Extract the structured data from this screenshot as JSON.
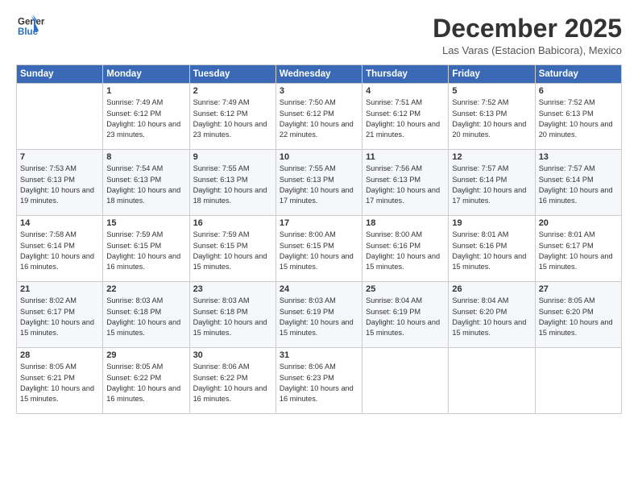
{
  "header": {
    "logo_line1": "General",
    "logo_line2": "Blue",
    "title": "December 2025",
    "subtitle": "Las Varas (Estacion Babicora), Mexico"
  },
  "columns": [
    "Sunday",
    "Monday",
    "Tuesday",
    "Wednesday",
    "Thursday",
    "Friday",
    "Saturday"
  ],
  "weeks": [
    [
      {
        "day": "",
        "sunrise": "",
        "sunset": "",
        "daylight": ""
      },
      {
        "day": "1",
        "sunrise": "Sunrise: 7:49 AM",
        "sunset": "Sunset: 6:12 PM",
        "daylight": "Daylight: 10 hours and 23 minutes."
      },
      {
        "day": "2",
        "sunrise": "Sunrise: 7:49 AM",
        "sunset": "Sunset: 6:12 PM",
        "daylight": "Daylight: 10 hours and 23 minutes."
      },
      {
        "day": "3",
        "sunrise": "Sunrise: 7:50 AM",
        "sunset": "Sunset: 6:12 PM",
        "daylight": "Daylight: 10 hours and 22 minutes."
      },
      {
        "day": "4",
        "sunrise": "Sunrise: 7:51 AM",
        "sunset": "Sunset: 6:12 PM",
        "daylight": "Daylight: 10 hours and 21 minutes."
      },
      {
        "day": "5",
        "sunrise": "Sunrise: 7:52 AM",
        "sunset": "Sunset: 6:13 PM",
        "daylight": "Daylight: 10 hours and 20 minutes."
      },
      {
        "day": "6",
        "sunrise": "Sunrise: 7:52 AM",
        "sunset": "Sunset: 6:13 PM",
        "daylight": "Daylight: 10 hours and 20 minutes."
      }
    ],
    [
      {
        "day": "7",
        "sunrise": "Sunrise: 7:53 AM",
        "sunset": "Sunset: 6:13 PM",
        "daylight": "Daylight: 10 hours and 19 minutes."
      },
      {
        "day": "8",
        "sunrise": "Sunrise: 7:54 AM",
        "sunset": "Sunset: 6:13 PM",
        "daylight": "Daylight: 10 hours and 18 minutes."
      },
      {
        "day": "9",
        "sunrise": "Sunrise: 7:55 AM",
        "sunset": "Sunset: 6:13 PM",
        "daylight": "Daylight: 10 hours and 18 minutes."
      },
      {
        "day": "10",
        "sunrise": "Sunrise: 7:55 AM",
        "sunset": "Sunset: 6:13 PM",
        "daylight": "Daylight: 10 hours and 17 minutes."
      },
      {
        "day": "11",
        "sunrise": "Sunrise: 7:56 AM",
        "sunset": "Sunset: 6:13 PM",
        "daylight": "Daylight: 10 hours and 17 minutes."
      },
      {
        "day": "12",
        "sunrise": "Sunrise: 7:57 AM",
        "sunset": "Sunset: 6:14 PM",
        "daylight": "Daylight: 10 hours and 17 minutes."
      },
      {
        "day": "13",
        "sunrise": "Sunrise: 7:57 AM",
        "sunset": "Sunset: 6:14 PM",
        "daylight": "Daylight: 10 hours and 16 minutes."
      }
    ],
    [
      {
        "day": "14",
        "sunrise": "Sunrise: 7:58 AM",
        "sunset": "Sunset: 6:14 PM",
        "daylight": "Daylight: 10 hours and 16 minutes."
      },
      {
        "day": "15",
        "sunrise": "Sunrise: 7:59 AM",
        "sunset": "Sunset: 6:15 PM",
        "daylight": "Daylight: 10 hours and 16 minutes."
      },
      {
        "day": "16",
        "sunrise": "Sunrise: 7:59 AM",
        "sunset": "Sunset: 6:15 PM",
        "daylight": "Daylight: 10 hours and 15 minutes."
      },
      {
        "day": "17",
        "sunrise": "Sunrise: 8:00 AM",
        "sunset": "Sunset: 6:15 PM",
        "daylight": "Daylight: 10 hours and 15 minutes."
      },
      {
        "day": "18",
        "sunrise": "Sunrise: 8:00 AM",
        "sunset": "Sunset: 6:16 PM",
        "daylight": "Daylight: 10 hours and 15 minutes."
      },
      {
        "day": "19",
        "sunrise": "Sunrise: 8:01 AM",
        "sunset": "Sunset: 6:16 PM",
        "daylight": "Daylight: 10 hours and 15 minutes."
      },
      {
        "day": "20",
        "sunrise": "Sunrise: 8:01 AM",
        "sunset": "Sunset: 6:17 PM",
        "daylight": "Daylight: 10 hours and 15 minutes."
      }
    ],
    [
      {
        "day": "21",
        "sunrise": "Sunrise: 8:02 AM",
        "sunset": "Sunset: 6:17 PM",
        "daylight": "Daylight: 10 hours and 15 minutes."
      },
      {
        "day": "22",
        "sunrise": "Sunrise: 8:03 AM",
        "sunset": "Sunset: 6:18 PM",
        "daylight": "Daylight: 10 hours and 15 minutes."
      },
      {
        "day": "23",
        "sunrise": "Sunrise: 8:03 AM",
        "sunset": "Sunset: 6:18 PM",
        "daylight": "Daylight: 10 hours and 15 minutes."
      },
      {
        "day": "24",
        "sunrise": "Sunrise: 8:03 AM",
        "sunset": "Sunset: 6:19 PM",
        "daylight": "Daylight: 10 hours and 15 minutes."
      },
      {
        "day": "25",
        "sunrise": "Sunrise: 8:04 AM",
        "sunset": "Sunset: 6:19 PM",
        "daylight": "Daylight: 10 hours and 15 minutes."
      },
      {
        "day": "26",
        "sunrise": "Sunrise: 8:04 AM",
        "sunset": "Sunset: 6:20 PM",
        "daylight": "Daylight: 10 hours and 15 minutes."
      },
      {
        "day": "27",
        "sunrise": "Sunrise: 8:05 AM",
        "sunset": "Sunset: 6:20 PM",
        "daylight": "Daylight: 10 hours and 15 minutes."
      }
    ],
    [
      {
        "day": "28",
        "sunrise": "Sunrise: 8:05 AM",
        "sunset": "Sunset: 6:21 PM",
        "daylight": "Daylight: 10 hours and 15 minutes."
      },
      {
        "day": "29",
        "sunrise": "Sunrise: 8:05 AM",
        "sunset": "Sunset: 6:22 PM",
        "daylight": "Daylight: 10 hours and 16 minutes."
      },
      {
        "day": "30",
        "sunrise": "Sunrise: 8:06 AM",
        "sunset": "Sunset: 6:22 PM",
        "daylight": "Daylight: 10 hours and 16 minutes."
      },
      {
        "day": "31",
        "sunrise": "Sunrise: 8:06 AM",
        "sunset": "Sunset: 6:23 PM",
        "daylight": "Daylight: 10 hours and 16 minutes."
      },
      {
        "day": "",
        "sunrise": "",
        "sunset": "",
        "daylight": ""
      },
      {
        "day": "",
        "sunrise": "",
        "sunset": "",
        "daylight": ""
      },
      {
        "day": "",
        "sunrise": "",
        "sunset": "",
        "daylight": ""
      }
    ]
  ]
}
